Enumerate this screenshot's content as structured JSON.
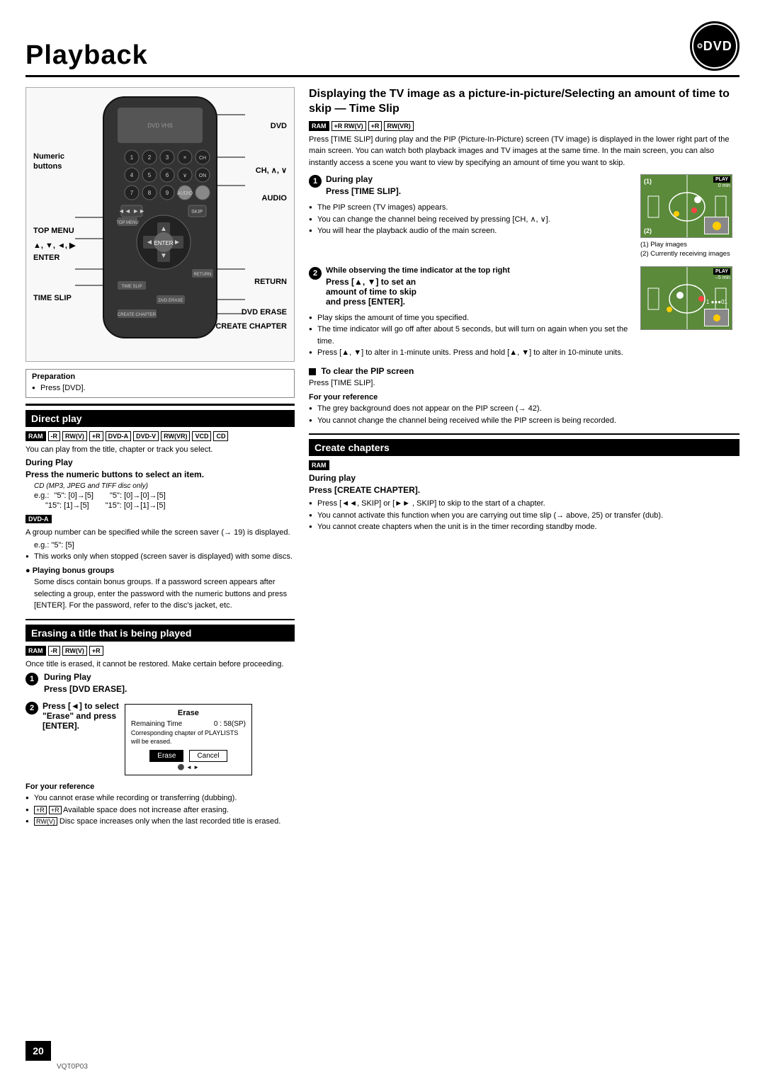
{
  "page": {
    "title": "Playback",
    "dvd_logo": "DVD",
    "page_number": "20",
    "vqt_code": "VQT0P03"
  },
  "remote_labels": {
    "numeric_buttons": "Numeric\nbuttons",
    "dvd": "DVD",
    "ch": "CH, ∧, ∨",
    "audio": "AUDIO",
    "top_menu": "TOP MENU",
    "arrows": "▲, ▼, ◄,  ▶",
    "enter": "ENTER",
    "return": "RETURN",
    "time_slip": "TIME SLIP",
    "dvd_erase": "DVD ERASE",
    "create_chapter": "CREATE CHAPTER",
    "prev_next": "◄◄,  ►► ",
    "rewind_ff": "◄◄, ►► "
  },
  "prep": {
    "title": "Preparation",
    "bullet": "Press [DVD]."
  },
  "direct_play": {
    "title": "Direct play",
    "badges": [
      "RAM",
      "-R",
      "RW(V)",
      "+R",
      "DVD-A",
      "DVD-V",
      "RW(VR)",
      "VCD",
      "CD"
    ],
    "description": "You can play from the title, chapter or track you select.",
    "during_play_title": "During Play",
    "step_text": "Press the numeric buttons to select an item.",
    "cd_note": "CD (MP3, JPEG and TIFF disc only)",
    "eg_label": "e.g.:",
    "example1_left": "\"5\":  [0]→[5]",
    "example1_right": "\"5\":  [0]→[0]→[5]",
    "example2_left": "\"15\":  [1]→[5]",
    "example2_right": "\"15\":  [0]→[1]→[5]",
    "dvd_a_title": "DVD-A",
    "dvd_a_text": "A group number can be specified while the screen saver (→ 19) is displayed.",
    "dvd_a_eg": "e.g.:  \"5\":  [5]",
    "dvd_a_bullet": "This works only when stopped (screen saver is displayed) with some discs.",
    "bonus_groups_title": "● Playing bonus groups",
    "bonus_groups_text": "Some discs contain bonus groups. If a password screen appears after selecting a group, enter the password with the numeric buttons and press [ENTER]. For the password, refer to the disc's jacket, etc."
  },
  "erasing": {
    "title": "Erasing a title that is being played",
    "badges": [
      "RAM",
      "-R",
      "RW(V)",
      "+R"
    ],
    "description": "Once title is erased, it cannot be restored. Make certain before proceeding.",
    "step1_number": "1",
    "step1_label": "During Play",
    "step1_text": "Press [DVD ERASE].",
    "step2_number": "2",
    "step2_text": "Press [◄] to select \"Erase\" and press [ENTER].",
    "dialog": {
      "title": "Erase",
      "row1_label": "Remaining Time",
      "row1_value": "0 : 58(SP)",
      "row2_text": "Corresponding chapter of PLAYLISTS will be erased.",
      "btn_erase": "Erase",
      "btn_cancel": "Cancel"
    },
    "for_ref_title": "For your reference",
    "ref_bullets": [
      "You cannot erase while recording or transferring (dubbing).",
      "+R  +R  Available space does not increase after erasing.",
      "RW(V)  Disc space increases only when the last recorded title is erased."
    ]
  },
  "time_slip": {
    "section_title": "Displaying the TV image as a picture-in-picture/Selecting an amount of time to skip — Time Slip",
    "badges": [
      "RAM",
      "+R RW(V)",
      "+R",
      "RW(VR)"
    ],
    "intro_text": "Press [TIME SLIP] during play and the PIP (Picture-In-Picture) screen (TV image) is displayed in the lower right part of the main screen. You can watch both playback images and TV images at the same time. In the main screen, you can also instantly access a scene you want to view by specifying an amount of time you want to skip.",
    "step1_number": "1",
    "step1_label": "During play",
    "step1_heading": "Press [TIME SLIP].",
    "step1_bullets": [
      "The PIP screen (TV images) appears.",
      "You can change the channel being received by pressing [CH, ∧, ∨].",
      "You will hear the playback audio of the main screen."
    ],
    "img1_caption1": "(1)  Play images",
    "img1_caption2": "(2)  Currently receiving images",
    "img1_play_label": "PLAY",
    "img1_time": "0 min",
    "step2_number": "2",
    "step2_label": "While observing the time indicator at the top right",
    "step2_heading": "Press [▲, ▼] to set an amount of time to skip and press [ENTER].",
    "step2_bullets": [
      "Play skips the amount of time you specified.",
      "The time indicator will go off after about 5 seconds, but will turn on again when you set the time.",
      "Press [▲, ▼] to alter in 1-minute units. Press and hold [▲, ▼] to alter in 10-minute units."
    ],
    "img2_play_label": "PLAY",
    "img2_time": "–5 min",
    "clear_title": "■ To clear the PIP screen",
    "clear_text": "Press [TIME SLIP].",
    "for_ref_title": "For your reference",
    "for_ref_bullets": [
      "The grey background does not appear on the PIP screen (→ 42).",
      "You cannot change the channel being received while the PIP screen is being recorded."
    ]
  },
  "create_chapters": {
    "title": "Create chapters",
    "badge": "RAM",
    "during_play": "During play",
    "heading": "Press [CREATE CHAPTER].",
    "bullets": [
      "Press [◄◄, SKIP] or [►► , SKIP] to skip to the start of a chapter.",
      "You cannot activate this function when you are carrying out time slip (→ above, 25) or transfer (dub).",
      "You cannot create chapters when the unit is in the timer recording standby mode."
    ]
  }
}
